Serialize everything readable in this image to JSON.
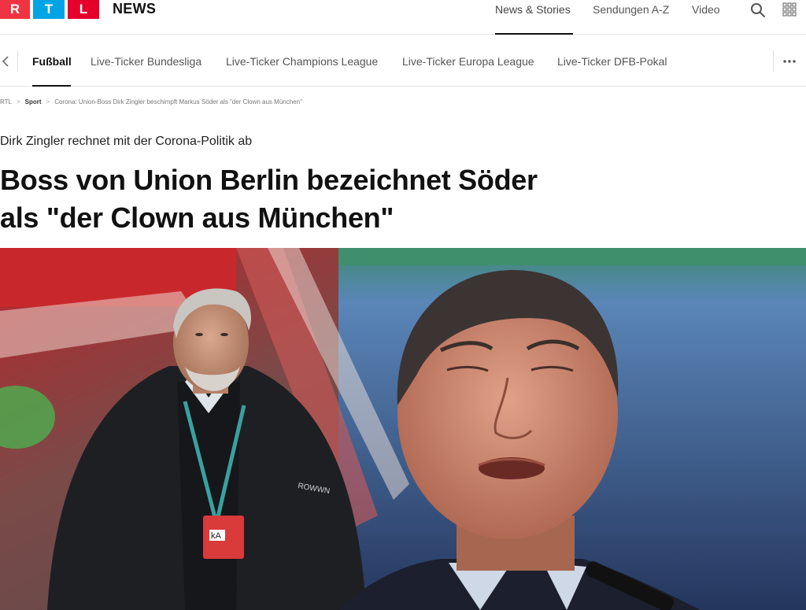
{
  "header": {
    "logo_letters": [
      "R",
      "T",
      "L"
    ],
    "brand": "NEWS",
    "nav": [
      "News & Stories",
      "Sendungen A-Z",
      "Video"
    ],
    "icons": [
      "search-icon",
      "grid-menu-icon"
    ]
  },
  "subnav": {
    "tabs": [
      "Fußball",
      "Live-Ticker Bundesliga",
      "Live-Ticker Champions League",
      "Live-Ticker Europa League",
      "Live-Ticker DFB-Pokal"
    ],
    "icons": [
      "chevron-left-icon",
      "more-dots-icon"
    ]
  },
  "breadcrumb": {
    "items": [
      "RTL",
      "Sport",
      "Corona: Union-Boss Dirk Zingler beschimpft Markus Söder als \"der Clown aus München\""
    ],
    "separator": ">"
  },
  "article": {
    "kicker": "Dirk Zingler rechnet mit der Corona-Politik ab",
    "headline_line1": "Boss von Union Berlin bezeichnet Söder",
    "headline_line2": "als \"der Clown aus München\""
  },
  "hero": {
    "badge_text": "kA",
    "jacket_text": "ROWWN"
  },
  "colors": {
    "rtl_red": "#ef3340",
    "rtl_blue": "#00a4e4",
    "rtl_red2": "#e4002b",
    "text": "#111111",
    "muted": "#555555"
  }
}
